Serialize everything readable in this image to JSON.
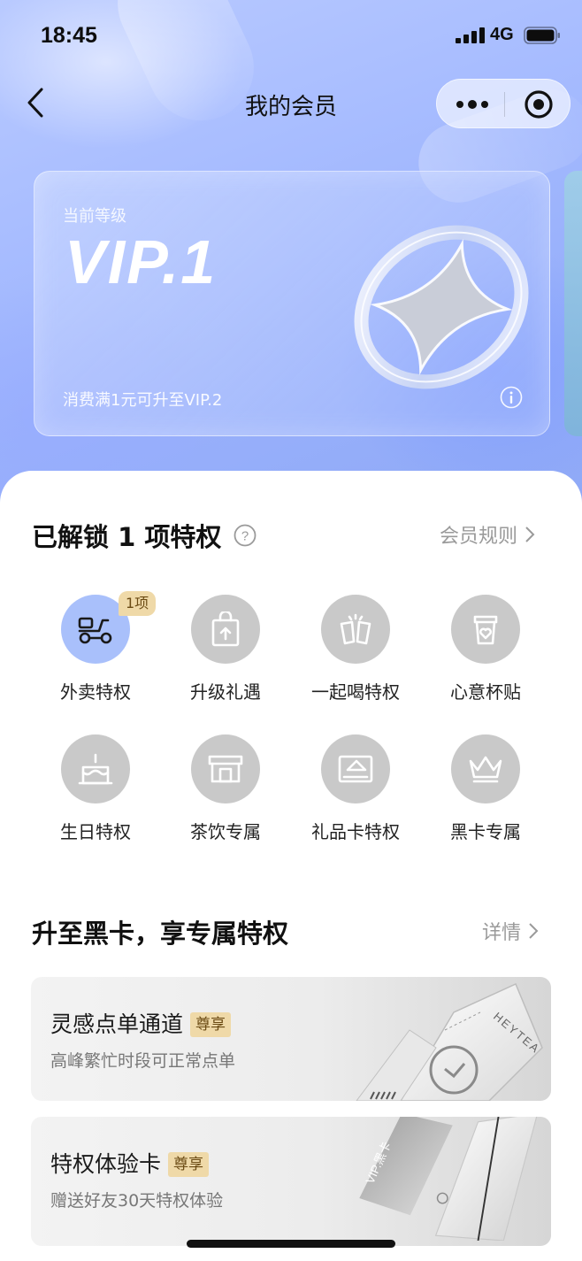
{
  "status_bar": {
    "time": "18:45",
    "network": "4G"
  },
  "nav": {
    "title": "我的会员"
  },
  "vip_card": {
    "level_label": "当前等级",
    "level_value": "VIP.1",
    "upgrade_hint": "消费满1元可升至VIP.2"
  },
  "perks_section": {
    "title": "已解锁 1 项特权",
    "rules_link": "会员规则",
    "items": [
      {
        "label": "外卖特权",
        "icon": "scooter-icon",
        "badge": "1项",
        "active": true
      },
      {
        "label": "升级礼遇",
        "icon": "gift-bag-icon"
      },
      {
        "label": "一起喝特权",
        "icon": "cheers-icon"
      },
      {
        "label": "心意杯贴",
        "icon": "cup-heart-icon"
      },
      {
        "label": "生日特权",
        "icon": "cake-icon"
      },
      {
        "label": "茶饮专属",
        "icon": "store-icon"
      },
      {
        "label": "礼品卡特权",
        "icon": "gift-card-icon"
      },
      {
        "label": "黑卡专属",
        "icon": "crown-icon"
      }
    ]
  },
  "blackcard_section": {
    "title": "升至黑卡，享专属特权",
    "details_link": "详情",
    "promos": [
      {
        "title": "灵感点单通道",
        "tag": "尊享",
        "desc": "高峰繁忙时段可正常点单",
        "art_text": "HEYTEA"
      },
      {
        "title": "特权体验卡",
        "tag": "尊享",
        "desc": "赠送好友30天特权体验",
        "art_text": "VIP.黑卡"
      }
    ]
  },
  "colors": {
    "hero": "#a7bcff",
    "active_perk": "#a9c0fb",
    "inactive_perk": "#c9c9c9",
    "tag_bg": "#efd9a8"
  }
}
